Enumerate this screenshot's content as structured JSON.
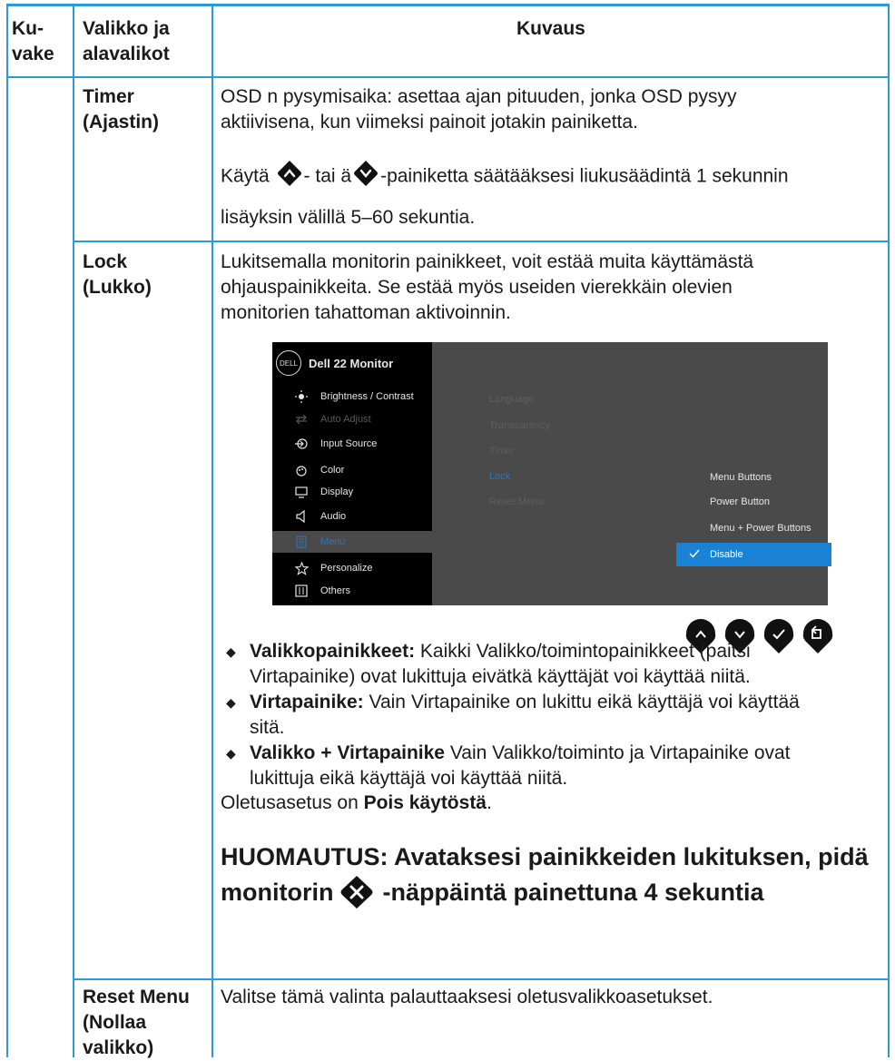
{
  "header": {
    "col1": [
      "Ku-",
      "vake"
    ],
    "col2": [
      "Valikko ja",
      "alavalikot"
    ],
    "col3": "Kuvaus"
  },
  "rows": {
    "timer": {
      "name": [
        "Timer",
        "(Ajastin)"
      ],
      "line1": "OSD n pysymisaika: asettaa ajan pituuden, jonka OSD pysyy",
      "line2": "aktiivisena, kun viimeksi painoit jotakin painiketta.",
      "line3_pre": "Käytä ",
      "line3_mid": "- tai ä",
      "line3_post": "-painiketta säätääksesi liukusäädintä 1 sekunnin",
      "line4": "lisäyksin välillä 5–60 sekuntia."
    },
    "lock": {
      "name": [
        "Lock",
        "(Lukko)"
      ],
      "line1": "Lukitsemalla monitorin painikkeet, voit estää muita käyttämästä",
      "line2": "ohjauspainikkeita. Se estää myös useiden vierekkäin olevien",
      "line3": "monitorien tahattoman aktivoinnin.",
      "bullets": [
        {
          "bold": "Valikkopainikkeet:",
          "lines": [
            " Kaikki Valikko/toimintopainikkeet (paitsi",
            "Virtapainike) ovat lukittuja eivätkä käyttäjät voi käyttää niitä."
          ]
        },
        {
          "bold": "Virtapainike:",
          "lines": [
            " Vain Virtapainike on lukittu eikä käyttäjä voi käyttää",
            "sitä."
          ]
        },
        {
          "bold": "Valikko + Virtapainike",
          "lines": [
            " Vain Valikko/toiminto ja Virtapainike ovat",
            "lukittuja eikä käyttäjä voi käyttää niitä."
          ]
        }
      ],
      "default_pre": "Oletusasetus on ",
      "default_bold": "Pois käytöstä",
      "default_post": ".",
      "note_line1": "HUOMAUTUS: Avataksesi painikkeiden lukituksen, pidä",
      "note_line2_pre": "monitorin ",
      "note_line2_post": "-näppäintä painettuna 4 sekuntia"
    },
    "reset": {
      "name": [
        "Reset Menu",
        "(Nollaa",
        "valikko)"
      ],
      "line1": "Valitse tämä valinta palauttaaksesi oletusvalikkoasetukset."
    }
  },
  "osd": {
    "logo": "DELL",
    "title": "Dell 22 Monitor",
    "menu": [
      {
        "label": "Brightness / Contrast",
        "icon": "brightness-icon",
        "state": "normal"
      },
      {
        "label": "Auto Adjust",
        "icon": "auto-adjust-icon",
        "state": "dim"
      },
      {
        "label": "Input Source",
        "icon": "input-source-icon",
        "state": "normal"
      },
      {
        "label": "Color",
        "icon": "color-icon",
        "state": "normal"
      },
      {
        "label": "Display",
        "icon": "display-icon",
        "state": "normal"
      },
      {
        "label": "Audio",
        "icon": "audio-icon",
        "state": "normal"
      },
      {
        "label": "Menu",
        "icon": "menu-icon",
        "state": "selected"
      },
      {
        "label": "Personalize",
        "icon": "star-icon",
        "state": "normal"
      },
      {
        "label": "Others",
        "icon": "others-icon",
        "state": "normal"
      }
    ],
    "submenu": [
      "Language",
      "Transparency",
      "Timer",
      "Lock",
      "Reset Menu"
    ],
    "options": [
      "Menu Buttons",
      "Power Button",
      "Menu + Power Buttons",
      "Disable"
    ],
    "buttons": [
      "up-button",
      "down-button",
      "ok-button",
      "back-button"
    ]
  },
  "colors": {
    "table_line": "#2c9ad6",
    "highlight": "#1a82d4",
    "osd_selected_text": "#2e72b8"
  }
}
